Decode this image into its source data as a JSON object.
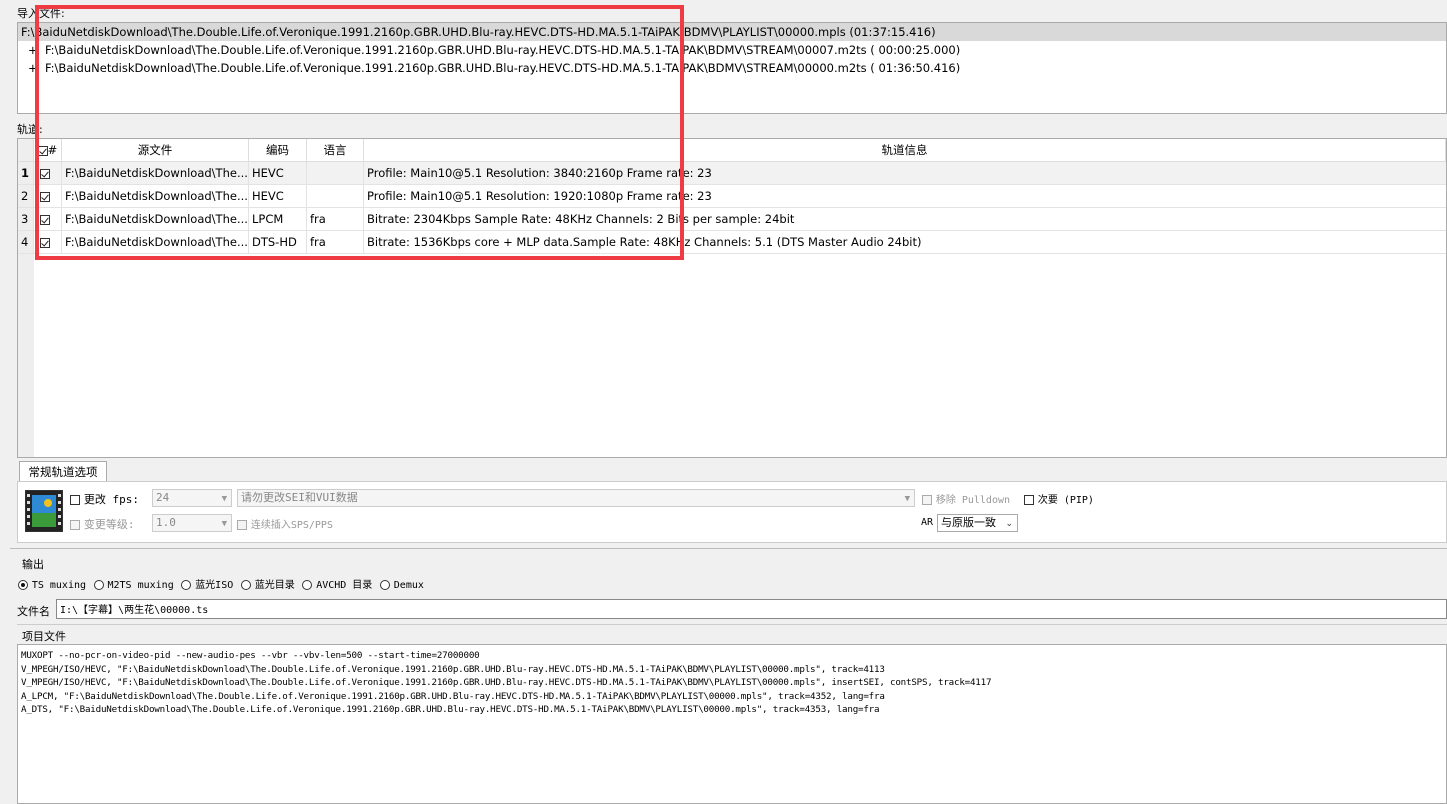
{
  "import_section": {
    "label": "导入文件:",
    "items": [
      {
        "prefix": "",
        "text": "F:\\BaiduNetdiskDownload\\The.Double.Life.of.Veronique.1991.2160p.GBR.UHD.Blu-ray.HEVC.DTS-HD.MA.5.1-TAiPAK\\BDMV\\PLAYLIST\\00000.mpls (01:37:15.416)"
      },
      {
        "prefix": "+",
        "text": "F:\\BaiduNetdiskDownload\\The.Double.Life.of.Veronique.1991.2160p.GBR.UHD.Blu-ray.HEVC.DTS-HD.MA.5.1-TAiPAK\\BDMV\\STREAM\\00007.m2ts ( 00:00:25.000)"
      },
      {
        "prefix": "+",
        "text": "F:\\BaiduNetdiskDownload\\The.Double.Life.of.Veronique.1991.2160p.GBR.UHD.Blu-ray.HEVC.DTS-HD.MA.5.1-TAiPAK\\BDMV\\STREAM\\00000.m2ts ( 01:36:50.416)"
      }
    ]
  },
  "tracks_section": {
    "label": "轨道:",
    "columns": {
      "num": "#",
      "source": "源文件",
      "codec": "编码",
      "lang": "语言",
      "info": "轨道信息"
    },
    "rows": [
      {
        "num": "1",
        "source": "F:\\BaiduNetdiskDownload\\The....",
        "codec": "HEVC",
        "lang": "",
        "info": "Profile: Main10@5.1  Resolution: 3840:2160p  Frame rate: 23"
      },
      {
        "num": "2",
        "source": "F:\\BaiduNetdiskDownload\\The....",
        "codec": "HEVC",
        "lang": "",
        "info": "Profile: Main10@5.1  Resolution: 1920:1080p  Frame rate: 23"
      },
      {
        "num": "3",
        "source": "F:\\BaiduNetdiskDownload\\The....",
        "codec": "LPCM",
        "lang": "fra",
        "info": "Bitrate: 2304Kbps  Sample Rate: 48KHz  Channels: 2  Bits per sample: 24bit"
      },
      {
        "num": "4",
        "source": "F:\\BaiduNetdiskDownload\\The....",
        "codec": "DTS-HD",
        "lang": "fra",
        "info": "Bitrate: 1536Kbps  core + MLP data.Sample Rate: 48KHz  Channels: 5.1 (DTS Master Audio 24bit)"
      }
    ]
  },
  "options": {
    "tab_label": "常规轨道选项",
    "change_fps_label": "更改 fps:",
    "fps_value": "24",
    "sei_value": "请勿更改SEI和VUI数据",
    "remove_pulldown_label": "移除 Pulldown",
    "secondary_pip_label": "次要 (PIP)",
    "change_level_label": "变更等级:",
    "level_value": "1.0",
    "insert_sps_label": "连续插入SPS/PPS",
    "ar_label": "AR",
    "ar_value": "与原版一致"
  },
  "output": {
    "label": "输出",
    "modes": [
      "TS muxing",
      "M2TS muxing",
      "蓝光ISO",
      "蓝光目录",
      "AVCHD 目录",
      "Demux"
    ],
    "filename_label": "文件名",
    "filename_value": "I:\\【字幕】\\两生花\\00000.ts"
  },
  "project": {
    "label": "项目文件",
    "lines": [
      "MUXOPT --no-pcr-on-video-pid --new-audio-pes --vbr --vbv-len=500 --start-time=27000000",
      "V_MPEGH/ISO/HEVC, \"F:\\BaiduNetdiskDownload\\The.Double.Life.of.Veronique.1991.2160p.GBR.UHD.Blu-ray.HEVC.DTS-HD.MA.5.1-TAiPAK\\BDMV\\PLAYLIST\\00000.mpls\", track=4113",
      "V_MPEGH/ISO/HEVC, \"F:\\BaiduNetdiskDownload\\The.Double.Life.of.Veronique.1991.2160p.GBR.UHD.Blu-ray.HEVC.DTS-HD.MA.5.1-TAiPAK\\BDMV\\PLAYLIST\\00000.mpls\", insertSEI, contSPS, track=4117",
      "A_LPCM, \"F:\\BaiduNetdiskDownload\\The.Double.Life.of.Veronique.1991.2160p.GBR.UHD.Blu-ray.HEVC.DTS-HD.MA.5.1-TAiPAK\\BDMV\\PLAYLIST\\00000.mpls\", track=4352, lang=fra",
      "A_DTS, \"F:\\BaiduNetdiskDownload\\The.Double.Life.of.Veronique.1991.2160p.GBR.UHD.Blu-ray.HEVC.DTS-HD.MA.5.1-TAiPAK\\BDMV\\PLAYLIST\\00000.mpls\", track=4353, lang=fra"
    ]
  }
}
